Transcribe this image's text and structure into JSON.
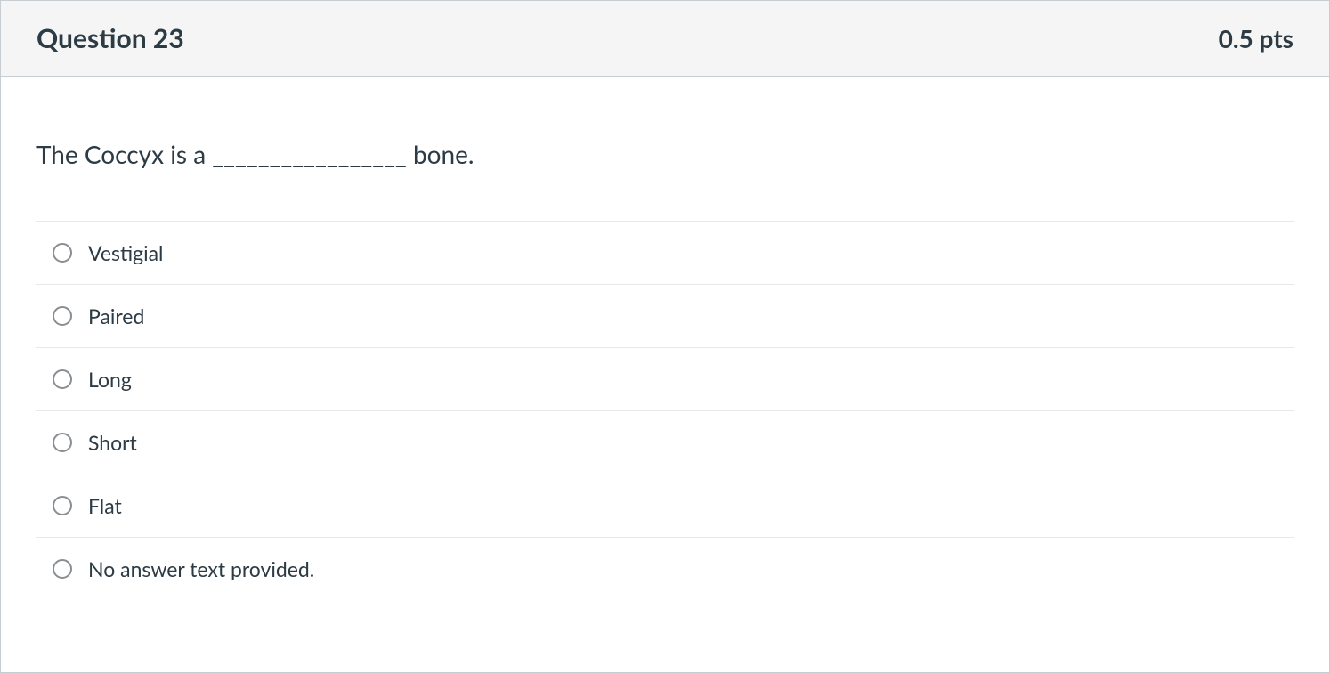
{
  "header": {
    "title": "Question 23",
    "points": "0.5 pts"
  },
  "question": {
    "text": "The Coccyx is a _________________ bone."
  },
  "answers": [
    {
      "label": "Vestigial"
    },
    {
      "label": "Paired"
    },
    {
      "label": "Long"
    },
    {
      "label": "Short"
    },
    {
      "label": "Flat"
    },
    {
      "label": "No answer text provided."
    }
  ]
}
